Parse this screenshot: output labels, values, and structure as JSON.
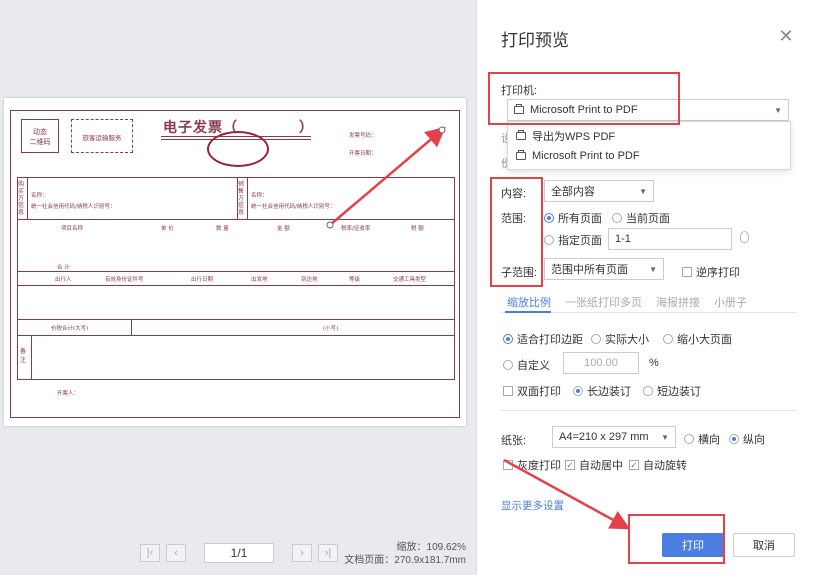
{
  "dialog": {
    "title": "打印预览"
  },
  "preview": {
    "invoice": {
      "dynamic_code": "动态\n二维码",
      "service_type": "旅客运输服务",
      "title": "电子发票（",
      "title_close": "）",
      "invoice_no_label": "发票号码：",
      "date_label": "开票日期：",
      "buyer_side": "购买方信息",
      "buyer_name": "名称：",
      "buyer_id": "统一社会信用代码/纳税人识别号：",
      "seller_side": "销售方信息",
      "seller_name": "名称：",
      "seller_id": "统一社会信用代码/纳税人识别号：",
      "col_item": "项目名称",
      "col_price": "单 价",
      "col_qty": "数 量",
      "col_amount": "金 额",
      "col_rate": "税率/征收率",
      "col_tax": "税 额",
      "total": "合 计",
      "traveler_cols": [
        "出行人",
        "有效身份证件号",
        "出行日期",
        "出发地",
        "到达地",
        "等级",
        "交通工具类型"
      ],
      "total_tax_label": "价税合计(大写)",
      "small_label": "(小写)",
      "remarks": "备注",
      "issuer": "开票人："
    },
    "page_indicator": "1/1",
    "zoom_label": "缩放：109.62%",
    "doc_size_label": "文档页面：270.9x181.7mm"
  },
  "printer": {
    "label": "打印机:",
    "selected": "Microsoft Print to PDF",
    "options": [
      "导出为WPS PDF",
      "Microsoft Print to PDF"
    ]
  },
  "content": {
    "label": "内容:",
    "value": "全部内容"
  },
  "range": {
    "label": "范围:",
    "all_pages": "所有页面",
    "current_page": "当前页面",
    "specified": "指定页面",
    "specified_value": "1-1"
  },
  "subrange": {
    "label": "子范围:",
    "value": "范围中所有页面",
    "reverse": "逆序打印"
  },
  "tabs": [
    "缩放比例",
    "一张纸打印多页",
    "海报拼接",
    "小册子"
  ],
  "scale": {
    "fit_margin": "适合打印边距",
    "actual": "实际大小",
    "shrink": "缩小大页面",
    "custom": "自定义",
    "custom_value": "100.00",
    "percent": "%"
  },
  "duplex": {
    "label": "双面打印",
    "long": "长边装订",
    "short": "短边装订"
  },
  "paper": {
    "label": "纸张:",
    "value": "A4=210 x 297 mm",
    "landscape": "横向",
    "portrait": "纵向"
  },
  "options": {
    "gray": "灰度打印",
    "center": "自动居中",
    "rotate": "自动旋转"
  },
  "more_settings": "显示更多设置",
  "buttons": {
    "print": "打印",
    "cancel": "取消"
  },
  "partial_labels": {
    "c1": "设",
    "c2": "份"
  }
}
